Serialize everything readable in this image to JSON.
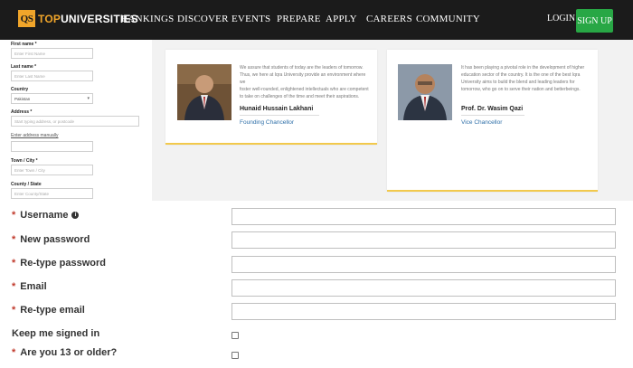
{
  "brand": {
    "badge": "QS",
    "name_top": "TOP",
    "name_rest": "UNIVERSITIES"
  },
  "nav": {
    "items": [
      "RANKINGS",
      "DISCOVER",
      "EVENTS",
      "PREPARE",
      "APPLY",
      "CAREERS",
      "COMMUNITY"
    ],
    "login": "LOGIN",
    "signup": "SIGN UP"
  },
  "mini_form": {
    "first_name_label": "First name *",
    "first_name_placeholder": "Enter First Name",
    "last_name_label": "Last name *",
    "last_name_placeholder": "Enter Last Name",
    "country_label": "Country",
    "country_value": "Pakistan",
    "address_label": "Address *",
    "address_placeholder": "Start typing address, or postcode",
    "enter_manually_link": "Enter address manually",
    "town_label": "Town / City *",
    "town_placeholder": "Enter Town / City",
    "county_label": "County / State",
    "county_placeholder": "Enter County/State"
  },
  "cards": [
    {
      "text_lines": [
        "We assure that students of today are the leaders of tomorrow.",
        "Thus, we here at Iqra University provide an environment where we",
        "foster well-rounded, enlightened intellectuals who are competent",
        "to take on challenges of the time and meet their aspirations."
      ],
      "name": "Hunaid Hussain Lakhani",
      "role": "Founding Chancellor"
    },
    {
      "text_lines": [
        "It has been playing a pivotal role in the development of higher",
        "education sector of the country. It is the one of the best Iqra",
        "University aims to build the blend and leading leaders for",
        "tomorrow, who go on to serve their nation and betterbeings."
      ],
      "name": "Prof. Dr. Wasim Qazi",
      "role": "Vice Chancellor"
    }
  ],
  "form": {
    "username": "Username",
    "new_password": "New password",
    "retype_password": "Re-type password",
    "email": "Email",
    "retype_email": "Re-type email",
    "keep_signed_in": "Keep me signed in",
    "age_question": "Are you 13 or older?",
    "required_mark": "*",
    "info_glyph": "i"
  },
  "colors": {
    "nav_bg": "#1b1b1b",
    "brand_orange": "#f0a52a",
    "signup_green": "#28a745",
    "required_red": "#c0392b",
    "card_accent": "#f2c94c",
    "role_blue": "#2e6fa8"
  }
}
